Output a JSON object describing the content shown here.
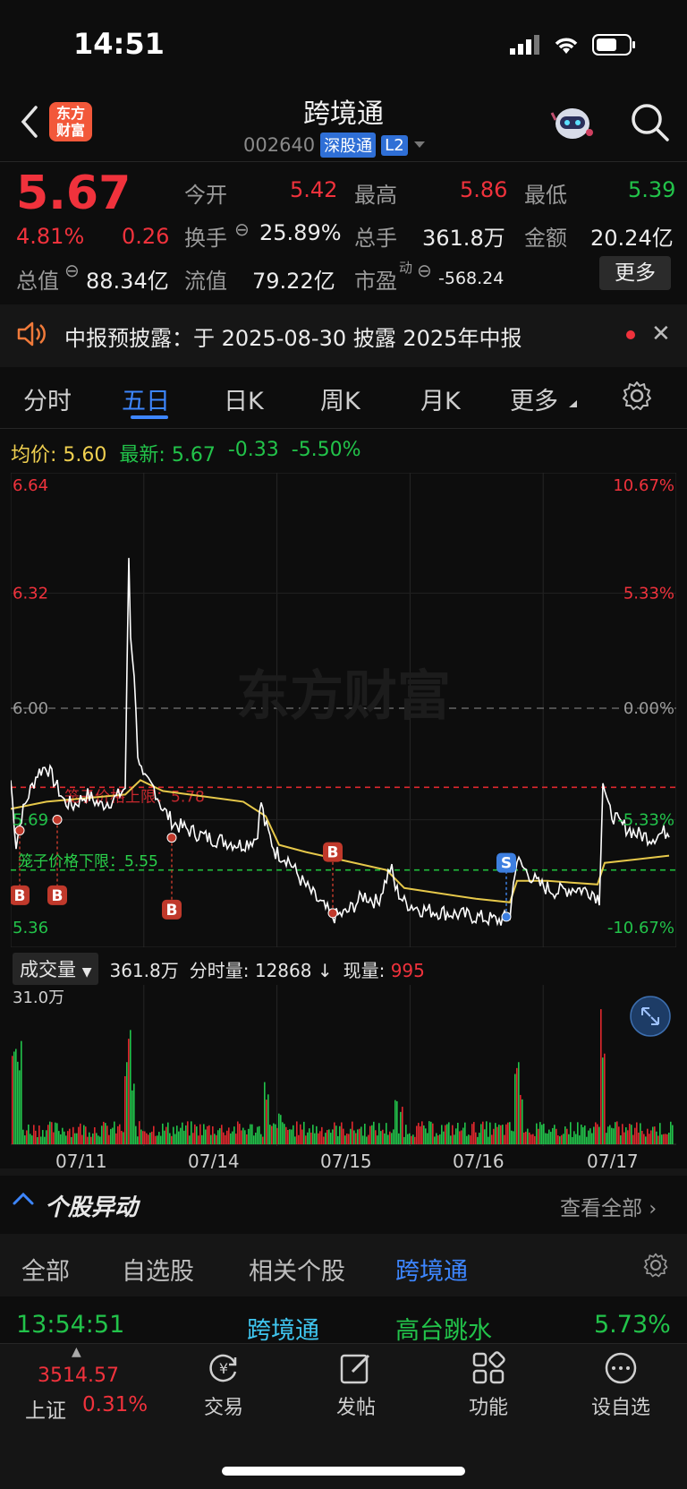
{
  "status_bar": {
    "time": "14:51"
  },
  "header": {
    "logo_line1": "东方",
    "logo_line2": "财富",
    "title": "跨境通",
    "code": "002640",
    "badge": "深股通",
    "level": "L2"
  },
  "quote": {
    "price": "5.67",
    "change_pct": "4.81%",
    "change": "0.26",
    "open_label": "今开",
    "open": "5.42",
    "high_label": "最高",
    "high": "5.86",
    "low_label": "最低",
    "low": "5.39",
    "turnover_label": "换手",
    "turnover": "25.89%",
    "volume_label": "总手",
    "volume": "361.8万",
    "amount_label": "金额",
    "amount": "20.24亿",
    "mktcap_label": "总值",
    "mktcap": "88.34亿",
    "float_label": "流值",
    "float": "79.22亿",
    "pe_label": "市盈",
    "pe_sup": "动",
    "pe": "-568.24",
    "more_button": "更多"
  },
  "notice": {
    "text": "中报预披露：于 2025-08-30 披露 2025年中报"
  },
  "tabs": [
    "分时",
    "五日",
    "日K",
    "周K",
    "月K",
    "更多"
  ],
  "active_tab": "五日",
  "chart_header": {
    "avg_label": "均价:",
    "avg": "5.60",
    "latest_label": "最新:",
    "latest": "5.67",
    "diff": "-0.33",
    "diff_pct": "-5.50%"
  },
  "chart_data": {
    "type": "line",
    "x": [
      "07/11",
      "07/14",
      "07/15",
      "07/16",
      "07/17"
    ],
    "ylim": [
      5.36,
      6.64
    ],
    "y_ticks_left": [
      "6.64",
      "6.32",
      "6.00",
      "5.69",
      "5.36"
    ],
    "y_ticks_right": [
      "10.67%",
      "5.33%",
      "0.00%",
      "-5.33%",
      "-10.67%"
    ],
    "annotations": {
      "upper_limit": "笼子价格上限：5.78",
      "lower_limit": "笼子价格下限：5.55",
      "buy_marker": "B",
      "sell_marker": "S"
    },
    "watermark": "东方财富",
    "colors": {
      "price": "#ffffff",
      "avg": "#e6c84a",
      "upper": "#e0282e",
      "lower": "#1fbf3c"
    }
  },
  "volume": {
    "selector": "成交量",
    "total": "361.8万",
    "tick_label": "分时量:",
    "tick": "12868",
    "arrow": "↓",
    "now_label": "现量:",
    "now": "995",
    "max_label": "31.0万"
  },
  "movement": {
    "title": "个股异动",
    "view_all": "查看全部",
    "filters": [
      "全部",
      "自选股",
      "相关个股",
      "跨境通"
    ],
    "active_filter": "跨境通",
    "row": {
      "time": "13:54:51",
      "name": "跨境通",
      "event": "高台跳水",
      "pct": "5.73%"
    }
  },
  "bottom_nav": {
    "index_value": "3514.57",
    "index_name": "上证",
    "index_pct": "0.31%",
    "items": [
      "交易",
      "发帖",
      "功能",
      "设自选"
    ]
  }
}
